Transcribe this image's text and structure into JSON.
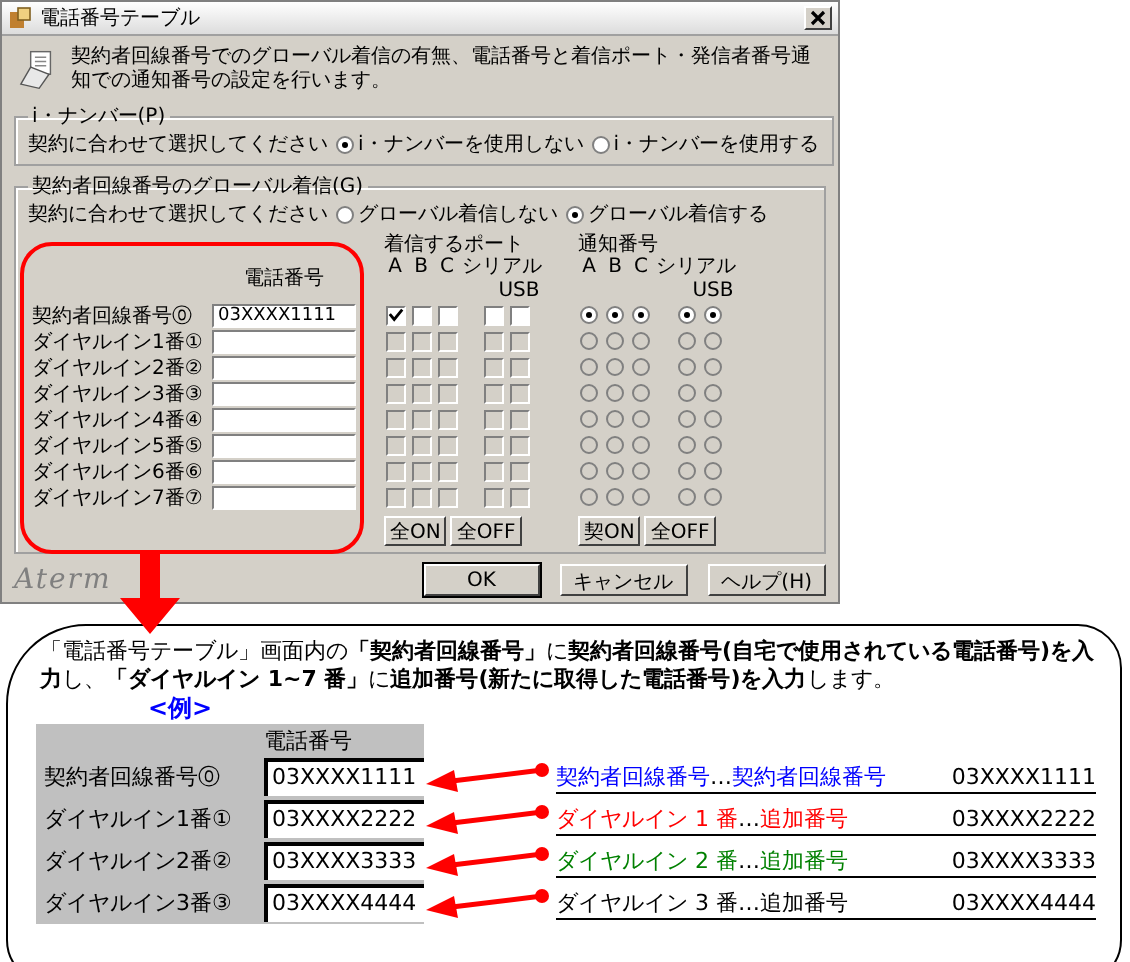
{
  "window": {
    "title": "電話番号テーブル"
  },
  "description": "契約者回線番号でのグローバル着信の有無、電話番号と着信ポート・発信者番号通知での通知番号の設定を行います。",
  "inumber": {
    "legend": "i・ナンバー(P)",
    "prompt": "契約に合わせて選択してください",
    "options": [
      {
        "label": "i・ナンバーを使用しない",
        "selected": true
      },
      {
        "label": "i・ナンバーを使用する",
        "selected": false
      }
    ]
  },
  "global": {
    "legend": "契約者回線番号のグローバル着信(G)",
    "prompt": "契約に合わせて選択してください",
    "options": [
      {
        "label": "グローバル着信しない",
        "selected": false
      },
      {
        "label": "グローバル着信する",
        "selected": true
      }
    ]
  },
  "table": {
    "phone_header": "電話番号",
    "port_header": "着信するポート",
    "notify_header": "通知番号",
    "port_columns": [
      "A",
      "B",
      "C",
      "シリアル",
      "USB"
    ],
    "notify_columns": [
      "A",
      "B",
      "C",
      "シリアル",
      "USB"
    ],
    "rows": [
      {
        "label": "契約者回線番号⓪",
        "number": "03XXXX1111",
        "disabled": false,
        "ports": [
          {
            "checked": true
          },
          {
            "checked": false
          },
          {
            "checked": false
          },
          {
            "checked": false
          },
          {
            "checked": false
          }
        ],
        "notify": [
          {
            "selected": true
          },
          {
            "selected": true
          },
          {
            "selected": true
          },
          {
            "selected": true
          },
          {
            "selected": true
          }
        ]
      },
      {
        "label": "ダイヤルイン1番①",
        "disabled": true,
        "ports": [
          {
            "checked": false
          },
          {
            "checked": false
          },
          {
            "checked": false
          },
          {
            "checked": false
          },
          {
            "checked": false
          }
        ],
        "notify": [
          {
            "selected": false
          },
          {
            "selected": false
          },
          {
            "selected": false
          },
          {
            "selected": false
          },
          {
            "selected": false
          }
        ]
      },
      {
        "label": "ダイヤルイン2番②",
        "disabled": true,
        "ports": [
          {
            "checked": false
          },
          {
            "checked": false
          },
          {
            "checked": false
          },
          {
            "checked": false
          },
          {
            "checked": false
          }
        ],
        "notify": [
          {
            "selected": false
          },
          {
            "selected": false
          },
          {
            "selected": false
          },
          {
            "selected": false
          },
          {
            "selected": false
          }
        ]
      },
      {
        "label": "ダイヤルイン3番③",
        "disabled": true,
        "ports": [
          {
            "checked": false
          },
          {
            "checked": false
          },
          {
            "checked": false
          },
          {
            "checked": false
          },
          {
            "checked": false
          }
        ],
        "notify": [
          {
            "selected": false
          },
          {
            "selected": false
          },
          {
            "selected": false
          },
          {
            "selected": false
          },
          {
            "selected": false
          }
        ]
      },
      {
        "label": "ダイヤルイン4番④",
        "disabled": true,
        "ports": [
          {
            "checked": false
          },
          {
            "checked": false
          },
          {
            "checked": false
          },
          {
            "checked": false
          },
          {
            "checked": false
          }
        ],
        "notify": [
          {
            "selected": false
          },
          {
            "selected": false
          },
          {
            "selected": false
          },
          {
            "selected": false
          },
          {
            "selected": false
          }
        ]
      },
      {
        "label": "ダイヤルイン5番⑤",
        "disabled": true,
        "ports": [
          {
            "checked": false
          },
          {
            "checked": false
          },
          {
            "checked": false
          },
          {
            "checked": false
          },
          {
            "checked": false
          }
        ],
        "notify": [
          {
            "selected": false
          },
          {
            "selected": false
          },
          {
            "selected": false
          },
          {
            "selected": false
          },
          {
            "selected": false
          }
        ]
      },
      {
        "label": "ダイヤルイン6番⑥",
        "disabled": true,
        "ports": [
          {
            "checked": false
          },
          {
            "checked": false
          },
          {
            "checked": false
          },
          {
            "checked": false
          },
          {
            "checked": false
          }
        ],
        "notify": [
          {
            "selected": false
          },
          {
            "selected": false
          },
          {
            "selected": false
          },
          {
            "selected": false
          },
          {
            "selected": false
          }
        ]
      },
      {
        "label": "ダイヤルイン7番⑦",
        "disabled": true,
        "ports": [
          {
            "checked": false
          },
          {
            "checked": false
          },
          {
            "checked": false
          },
          {
            "checked": false
          },
          {
            "checked": false
          }
        ],
        "notify": [
          {
            "selected": false
          },
          {
            "selected": false
          },
          {
            "selected": false
          },
          {
            "selected": false
          },
          {
            "selected": false
          }
        ]
      }
    ],
    "port_buttons": [
      "全ON",
      "全OFF"
    ],
    "notify_buttons": [
      "契ON",
      "全OFF"
    ]
  },
  "logo": "Aterm",
  "buttons": [
    {
      "label": "OK",
      "default": true
    },
    {
      "label": "キャンセル",
      "default": false
    },
    {
      "label": "ヘルプ(H)",
      "default": false
    }
  ],
  "callout": {
    "text": "「電話番号テーブル」画面内の**「契約者回線番号」**に**契約者回線番号(自宅で使用されている電話番号)を入力**し、**「ダイヤルイン 1~7 番」**に**追加番号(新たに取得した電話番号)を入力**します。",
    "example_title": "<例>",
    "example_header": "電話番号",
    "rows": [
      {
        "label": "契約者回線番号⓪",
        "number": "03XXXX1111",
        "name": "契約者回線番号",
        "separator": "…",
        "role": "契約者回線番号",
        "value": "03XXXX1111",
        "color": "#0000ff"
      },
      {
        "label": "ダイヤルイン1番①",
        "number": "03XXXX2222",
        "name": "ダイヤルイン 1 番",
        "separator": "…",
        "role": "追加番号",
        "value": "03XXXX2222",
        "color": "#ff0000"
      },
      {
        "label": "ダイヤルイン2番②",
        "number": "03XXXX3333",
        "name": "ダイヤルイン 2 番",
        "separator": "…",
        "role": "追加番号",
        "value": "03XXXX3333",
        "color": "#008000"
      },
      {
        "label": "ダイヤルイン3番③",
        "number": "03XXXX4444",
        "name": "ダイヤルイン 3 番",
        "separator": "…",
        "role": "追加番号",
        "value": "03XXXX4444",
        "color": "#000000"
      }
    ]
  }
}
